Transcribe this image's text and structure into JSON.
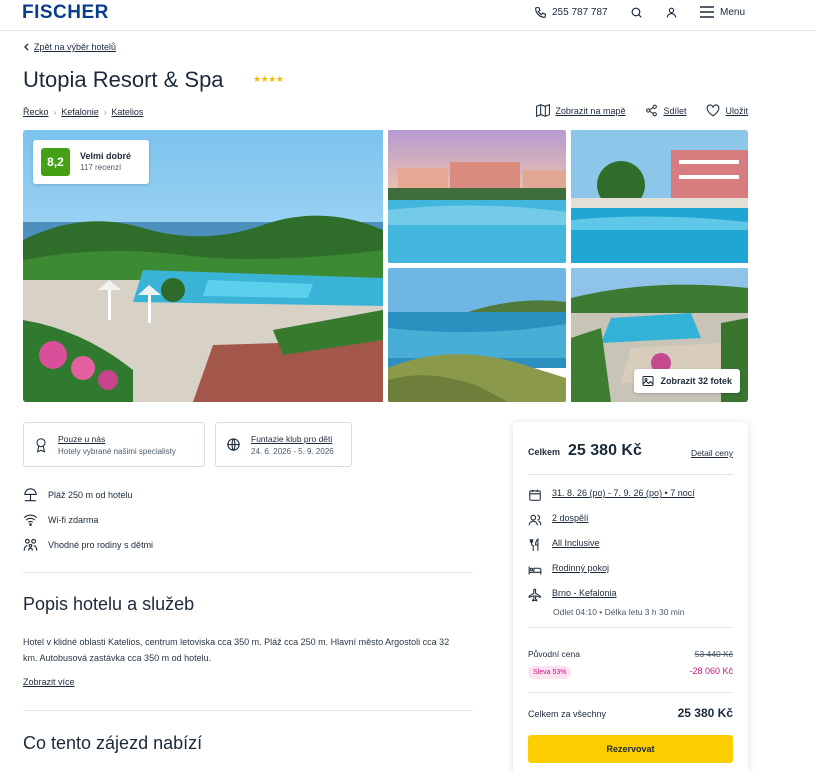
{
  "header": {
    "logo": "FISCHER",
    "phone": "255 787 787",
    "menu_label": "Menu"
  },
  "back_link": "Zpět na výběr hotelů",
  "hotel": {
    "name": "Utopia Resort & Spa",
    "stars": "★★★★"
  },
  "breadcrumbs": [
    "Řecko",
    "Kefalonie",
    "Katelios"
  ],
  "actions": {
    "map": "Zobrazit na mapě",
    "share": "Sdílet",
    "save": "Uložit"
  },
  "rating": {
    "score": "8,2",
    "label": "Velmi dobré",
    "count": "117 recenzí"
  },
  "gallery": {
    "show_photos": "Zobrazit 32 fotek"
  },
  "feature_cards": [
    {
      "title": "Pouze u nás",
      "subtitle": "Hotely vybrané našimi specialisty"
    },
    {
      "title": "Funtazie klub pro děti",
      "subtitle": "24. 6. 2026 - 5. 9. 2026"
    }
  ],
  "facilities": [
    "Pláž 250 m od hotelu",
    "Wi-fi zdarma",
    "Vhodné pro rodiny s dětmi"
  ],
  "description": {
    "heading": "Popis hotelu a služeb",
    "text": "Hotel v klidné oblasti Katelios, centrum letoviska cca 350 m. Pláž cca 250 m. Hlavní město Argostoli cca 32 km. Autobusová zastávka cca 350 m od hotelu.",
    "more": "Zobrazit více"
  },
  "offer_heading": "Co tento zájezd nabízí",
  "price": {
    "total_label": "Celkem",
    "total_value": "25 380 Kč",
    "detail_link": "Detail ceny",
    "dates": "31. 8. 26 (po) - 7. 9. 26 (po) • 7 nocí",
    "persons": "2 dospělí",
    "board": "All Inclusive",
    "room": "Rodinný pokoj",
    "flight": "Brno - Kefalonia",
    "flight_info": "Odlet 04:10 • Délka letu 3 h 30 min",
    "original_label": "Původní cena",
    "original_value": "53 440 Kč",
    "discount_badge": "Sleva 53%",
    "discount_value": "-28 060 Kč",
    "all_label": "Celkem za všechny",
    "all_value": "25 380 Kč",
    "reserve": "Rezervovat"
  },
  "colors": {
    "brand": "#0a3d8f",
    "rating_green": "#46a016",
    "cta_yellow": "#fccd00",
    "discount_pink": "#c2177a"
  }
}
